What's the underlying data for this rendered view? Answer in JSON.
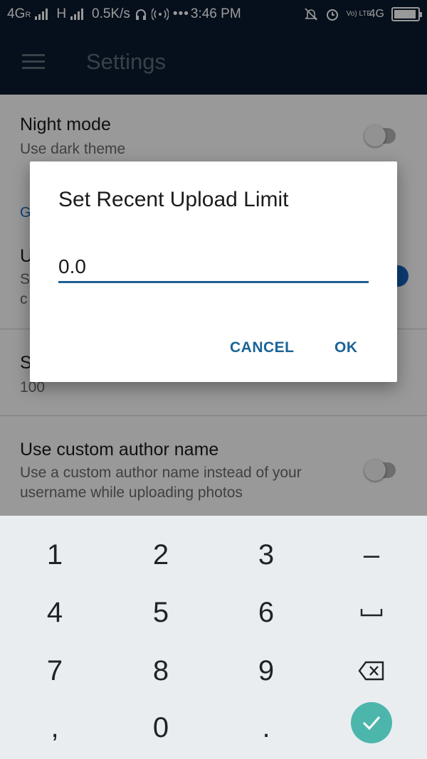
{
  "status_bar": {
    "network_left": "4G",
    "roaming_mark": "R",
    "network_second": "H",
    "speed": "0.5K/s",
    "time": "3:46 PM",
    "volte": "Vo) LTE",
    "network_right": "4G",
    "icons": [
      "signal-icon",
      "headphones-icon",
      "hotspot-icon",
      "mute-icon",
      "alarm-icon",
      "battery-icon"
    ]
  },
  "app_bar": {
    "title": "Settings"
  },
  "settings": {
    "night_mode": {
      "title": "Night mode",
      "summary": "Use dark theme",
      "enabled": false
    },
    "section_header_partial": "G",
    "upload_pref": {
      "title_partial": "U",
      "summary_line1_partial": "S",
      "summary_line2_partial": "c",
      "enabled": true
    },
    "limit_pref": {
      "title_partial": "S",
      "value": "100"
    },
    "custom_author": {
      "title": "Use custom author name",
      "summary": "Use a custom author name instead of your username while uploading photos",
      "enabled": false
    }
  },
  "dialog": {
    "title": "Set Recent Upload Limit",
    "input_value": "0.0",
    "cancel_label": "CANCEL",
    "ok_label": "OK"
  },
  "keyboard": {
    "keys": [
      "1",
      "2",
      "3",
      "–",
      "4",
      "5",
      "6",
      "␣",
      "7",
      "8",
      "9",
      "⌫",
      ",",
      "0",
      ".",
      "✓"
    ],
    "special_icons": {
      "space": "space-icon",
      "backspace": "backspace-icon",
      "done": "done-check-icon"
    },
    "accent_color": "#4db6ac"
  },
  "colors": {
    "primary_dark": "#0b1c2f",
    "accent": "#1565c0",
    "dialog_button": "#1a6496"
  }
}
